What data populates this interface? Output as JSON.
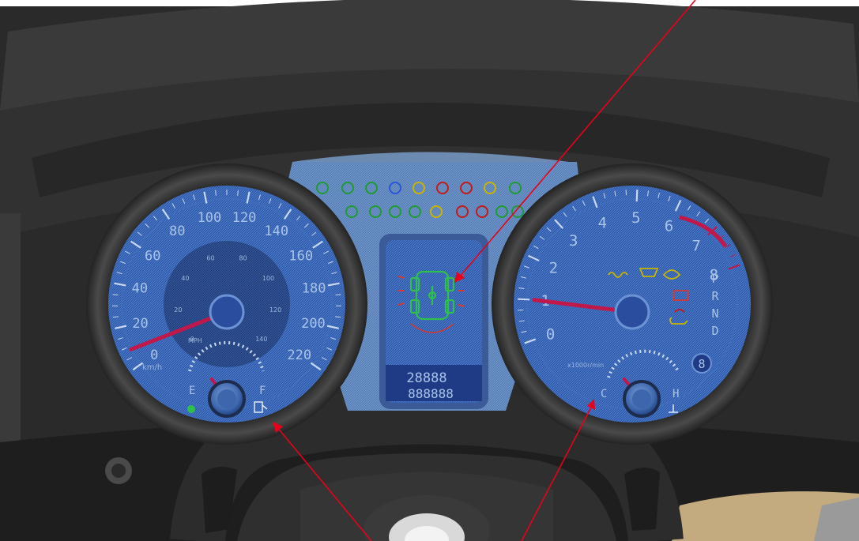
{
  "colors": {
    "dash_dark": "#2b2b2b",
    "dash_mid": "#3a3a3a",
    "gauge_face": "#2e5aa8",
    "gauge_ring": "#1c1c1c",
    "needle": "#c0184a",
    "annotation_arrow": "#e8001c",
    "lcd_blue": "#2a4d9e",
    "tell_green": "#1f9a34",
    "tell_yellow": "#c9b400",
    "tell_red": "#c41a1a",
    "trim_wood": "#c4ab7f"
  },
  "speedometer": {
    "speed_ticks": [
      "0",
      "20",
      "40",
      "60",
      "80",
      "100",
      "120",
      "140",
      "160",
      "180",
      "200",
      "220"
    ],
    "unit_kmh": "km/h",
    "unit_mph": "MPH",
    "inner_ticks": [
      "0",
      "20",
      "40",
      "60",
      "80",
      "100",
      "120",
      "140"
    ],
    "needle_value": 12
  },
  "fuel_gauge": {
    "empty_label": "E",
    "full_label": "F",
    "needle_value": 0.2
  },
  "tachometer": {
    "rpm_ticks": [
      "0",
      "1",
      "2",
      "3",
      "4",
      "5",
      "6",
      "7",
      "8"
    ],
    "unit": "x1000r/min",
    "needle_value": 1.2,
    "gear_indicators": [
      "P",
      "R",
      "N",
      "D"
    ],
    "gear_display": "8"
  },
  "temp_gauge": {
    "cold_label": "C",
    "hot_label": "H",
    "needle_value": 0.2
  },
  "center_display": {
    "odometer_top": "28888",
    "odometer_bottom": "888888"
  },
  "icons": [
    "tire-pressure-icon",
    "headlight-icon",
    "brake-warning-icon",
    "seatbelt-icon",
    "battery-icon",
    "oil-icon",
    "fuel-pump-icon"
  ]
}
